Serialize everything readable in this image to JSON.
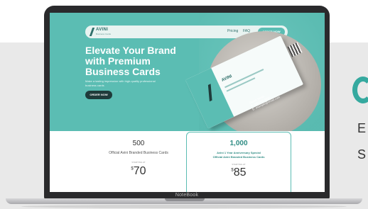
{
  "side": {
    "line1": "E",
    "line2": "S"
  },
  "laptop": {
    "brand": "NoteBook"
  },
  "nav": {
    "logo_word": "AVINI",
    "logo_tag": "Business Cards",
    "links": [
      "Pricing",
      "FAQ"
    ],
    "order_button": "ORDER NOW"
  },
  "hero": {
    "title_lines": [
      "Elevate Your Brand",
      "with Premium",
      "Business Cards"
    ],
    "subtitle": "Make a lasting impression with high-quality professional business cards",
    "cta": "ORDER NOW"
  },
  "business_card": {
    "name": "AVINI",
    "details": [
      "Daniel Smith",
      "P: 000 000 0000",
      "E: example@email.com"
    ]
  },
  "pricing": [
    {
      "quantity": "500",
      "description": "Official Avini Branded Business Cards",
      "small_label": "STARTING AT",
      "price_symbol": "$",
      "price": "70"
    },
    {
      "quantity": "1,000",
      "description_lines": [
        "Avini 1 Year Anniversary Special",
        "Official Avini Branded Business Cards"
      ],
      "small_label": "STARTING AT",
      "price_symbol": "$",
      "price": "85"
    }
  ],
  "colors": {
    "accent": "#5bbdb3",
    "dark": "#1f3b3a",
    "laptop": "#2a2a2c"
  }
}
